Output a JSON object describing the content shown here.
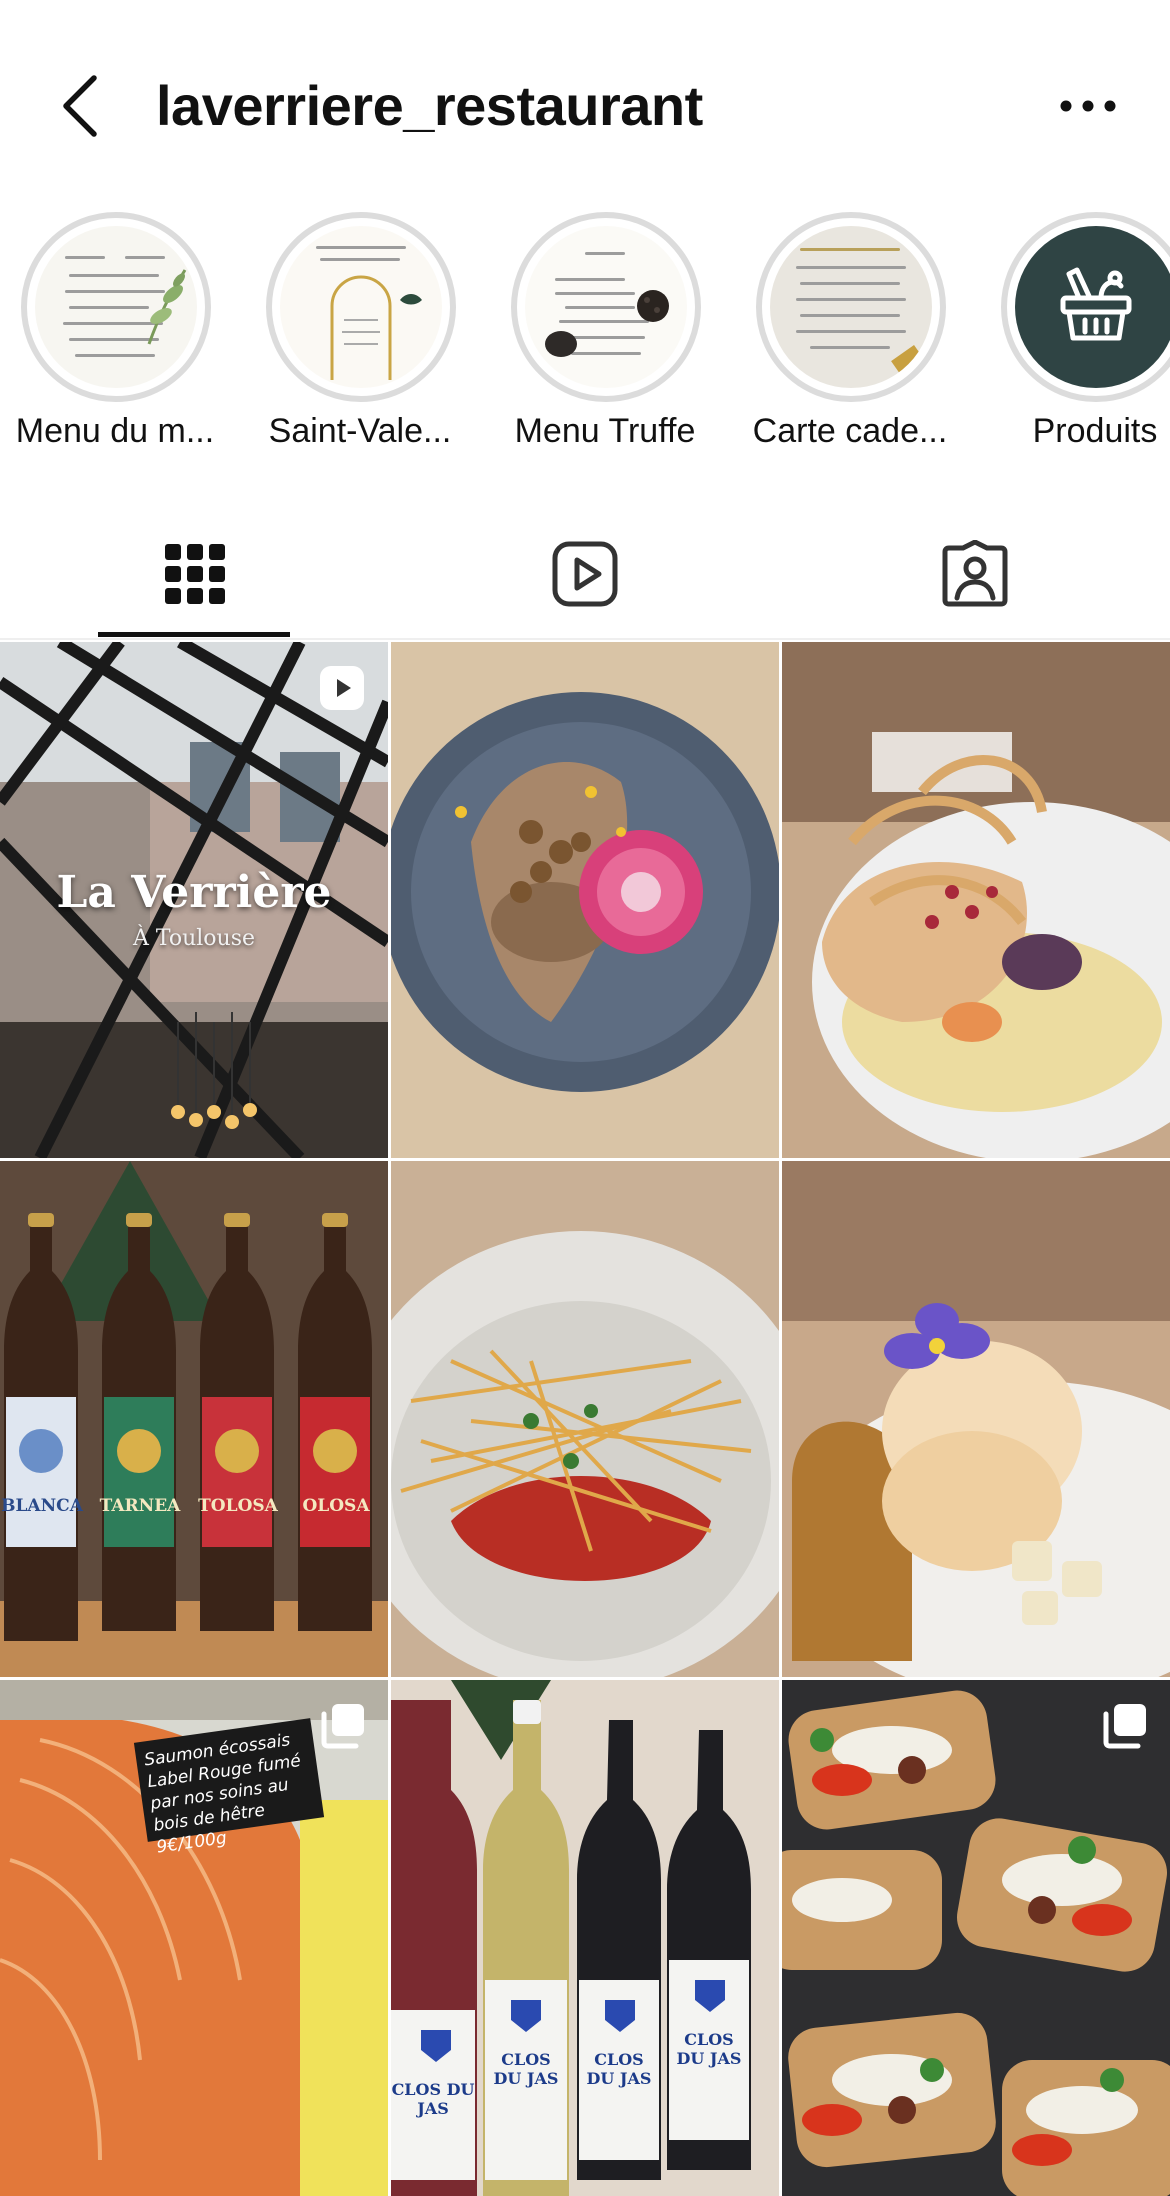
{
  "header": {
    "title": "laverriere_restaurant",
    "back_icon": "chevron-left-icon",
    "more_icon": "more-horizontal-icon"
  },
  "highlights": [
    {
      "label": "Menu du m...",
      "kind": "menu-card"
    },
    {
      "label": "Saint-Vale...",
      "kind": "arch-card"
    },
    {
      "label": "Menu Truffe",
      "kind": "truffle-card"
    },
    {
      "label": "Carte cade...",
      "kind": "gift-card"
    },
    {
      "label": "Produits",
      "kind": "basket-icon"
    }
  ],
  "tabs": [
    {
      "name": "posts-grid",
      "icon": "grid-icon",
      "active": true
    },
    {
      "name": "reels",
      "icon": "reels-icon",
      "active": false
    },
    {
      "name": "tagged",
      "icon": "tagged-user-icon",
      "active": false
    }
  ],
  "posts": [
    {
      "subject": "glass-roof-interior",
      "badge": "reel-icon",
      "overlay_title": "La Verrière",
      "overlay_subtitle": "À Toulouse"
    },
    {
      "subject": "plated-fish-radish",
      "badge": ""
    },
    {
      "subject": "fish-crispy-garnish",
      "badge": ""
    },
    {
      "subject": "craft-beer-bottles",
      "badge": "",
      "labels": [
        "BLANCA",
        "TARNEA",
        "TOLOSA",
        "OLOSA"
      ]
    },
    {
      "subject": "potato-straw-dish",
      "badge": ""
    },
    {
      "subject": "dessert-with-flower",
      "badge": ""
    },
    {
      "subject": "smoked-salmon",
      "badge": "carousel-icon",
      "sign_text": "Saumon écossais Label Rouge fumé par nos soins au bois de hêtre 9€/100g"
    },
    {
      "subject": "wine-bottles",
      "badge": "",
      "labels": [
        "CLOS DU JAS",
        "CLOS DU JAS",
        "CLOS DU JAS",
        "CLOS DU JAS"
      ]
    },
    {
      "subject": "toast-appetizers",
      "badge": "carousel-icon"
    }
  ],
  "colors": {
    "text": "#111111",
    "ring": "#dcdcdc",
    "produits_bg": "#2f4444"
  }
}
